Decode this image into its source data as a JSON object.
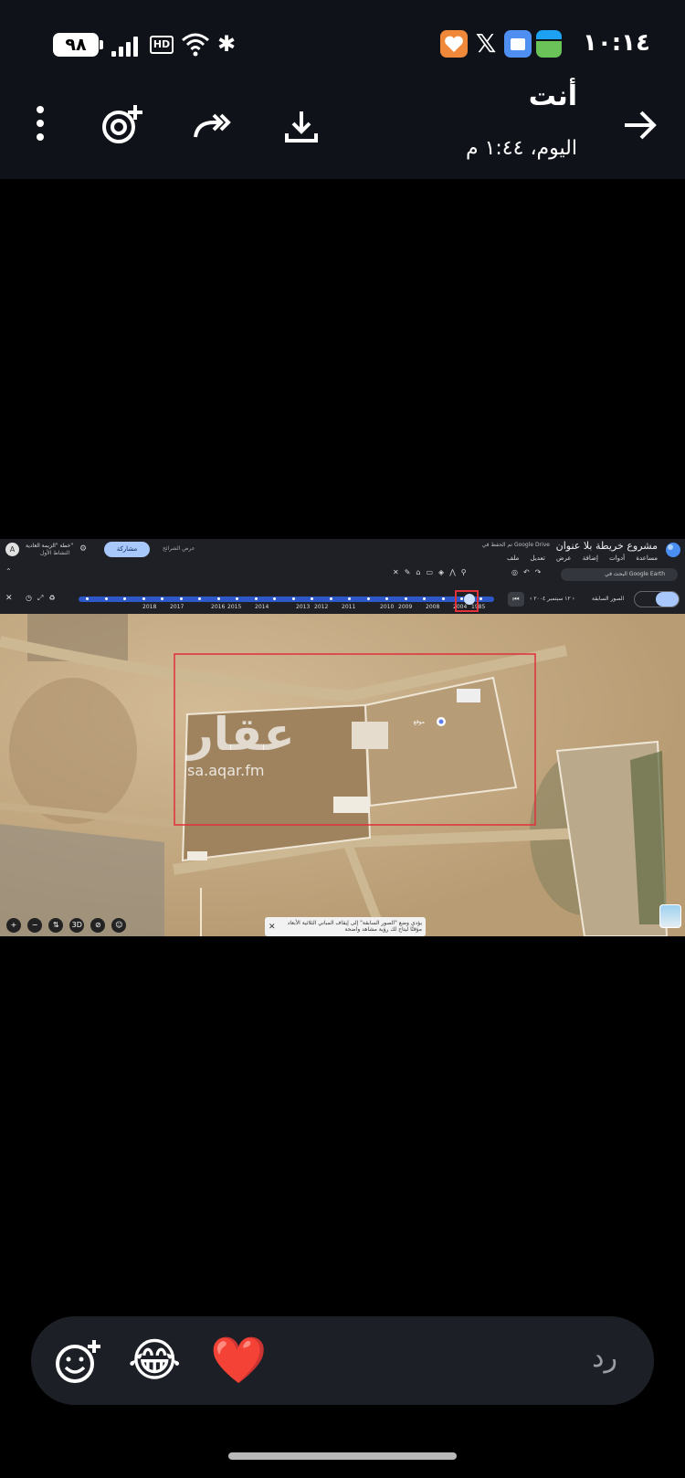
{
  "status_bar": {
    "battery": "٩٨",
    "network": "HD",
    "time": "١٠:١٤"
  },
  "header": {
    "contact_name": "أنت",
    "timestamp": "اليوم، ١:٤٤ م",
    "icons": [
      "more-vert-icon",
      "add-reaction-icon",
      "forward-icon",
      "download-icon",
      "back-arrow-icon"
    ]
  },
  "screenshot": {
    "project_title": "مشروع خريطة بلا عنوان",
    "drive_status": "تم الحفظ في Google Drive",
    "left_account": "خطة \"الزيمة العادية\"",
    "left_account_sub": "النشاط الأول",
    "menu": [
      "ملف",
      "تعديل",
      "عرض",
      "إضافة",
      "أدوات",
      "مساعدة"
    ],
    "share_label": "مشاركة",
    "present_label": "عرض الشرائح",
    "search_placeholder": "البحث في Google Earth",
    "timeline_nav": "الصور السابقة",
    "timeline_date": "١٢ سبتمبر ٢٠٠٤",
    "timeline_years": [
      "2018",
      "2017",
      "2016",
      "2015",
      "2014",
      "2013",
      "2012",
      "2011",
      "2010",
      "2009",
      "2008",
      "2004",
      "1985"
    ],
    "watermark_ar": "عقار",
    "watermark_url": "sa.aqar.fm",
    "notice_line1": "يؤدي وضع \"الصور السابقة\" إلى إيقاف المباني الثلاثية الأبعاد",
    "notice_line2": "مؤقتًا ليتاح لك رؤية مشاهد واضحة",
    "map_buttons": [
      "+",
      "−",
      "⇅",
      "3D",
      "⊘",
      "☺"
    ]
  },
  "reply": {
    "placeholder": "رد",
    "emojis": [
      "😂",
      "❤️"
    ]
  }
}
